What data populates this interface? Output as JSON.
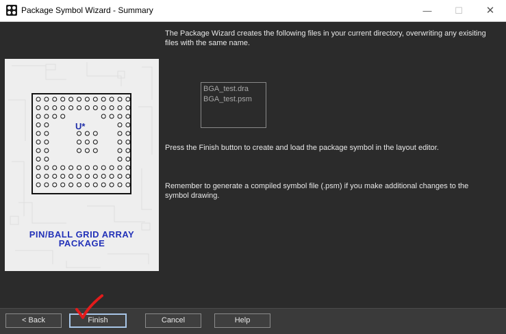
{
  "window": {
    "title": "Package Symbol Wizard - Summary",
    "controls": {
      "minimize": "—",
      "maximize": "☐",
      "close": "✕"
    }
  },
  "illustration": {
    "refdes": "U*",
    "caption_line1": "PIN/BALL GRID ARRAY",
    "caption_line2": "PACKAGE",
    "colors": {
      "caption": "#2231b8",
      "outline": "#111111"
    }
  },
  "main": {
    "intro": "The Package Wizard creates the following files in your current directory, overwriting any exisiting files with the same name.",
    "files": [
      "BGA_test.dra",
      "BGA_test.psm"
    ],
    "finish_note": "Press the Finish button to create and load the package symbol in the layout editor.",
    "reminder": "Remember to generate a compiled symbol file (.psm) if you make additional changes to the symbol drawing."
  },
  "buttons": {
    "back": "< Back",
    "finish": "Finish",
    "cancel": "Cancel",
    "help": "Help"
  },
  "annotation": {
    "checkmark_color": "#e21b1b"
  }
}
